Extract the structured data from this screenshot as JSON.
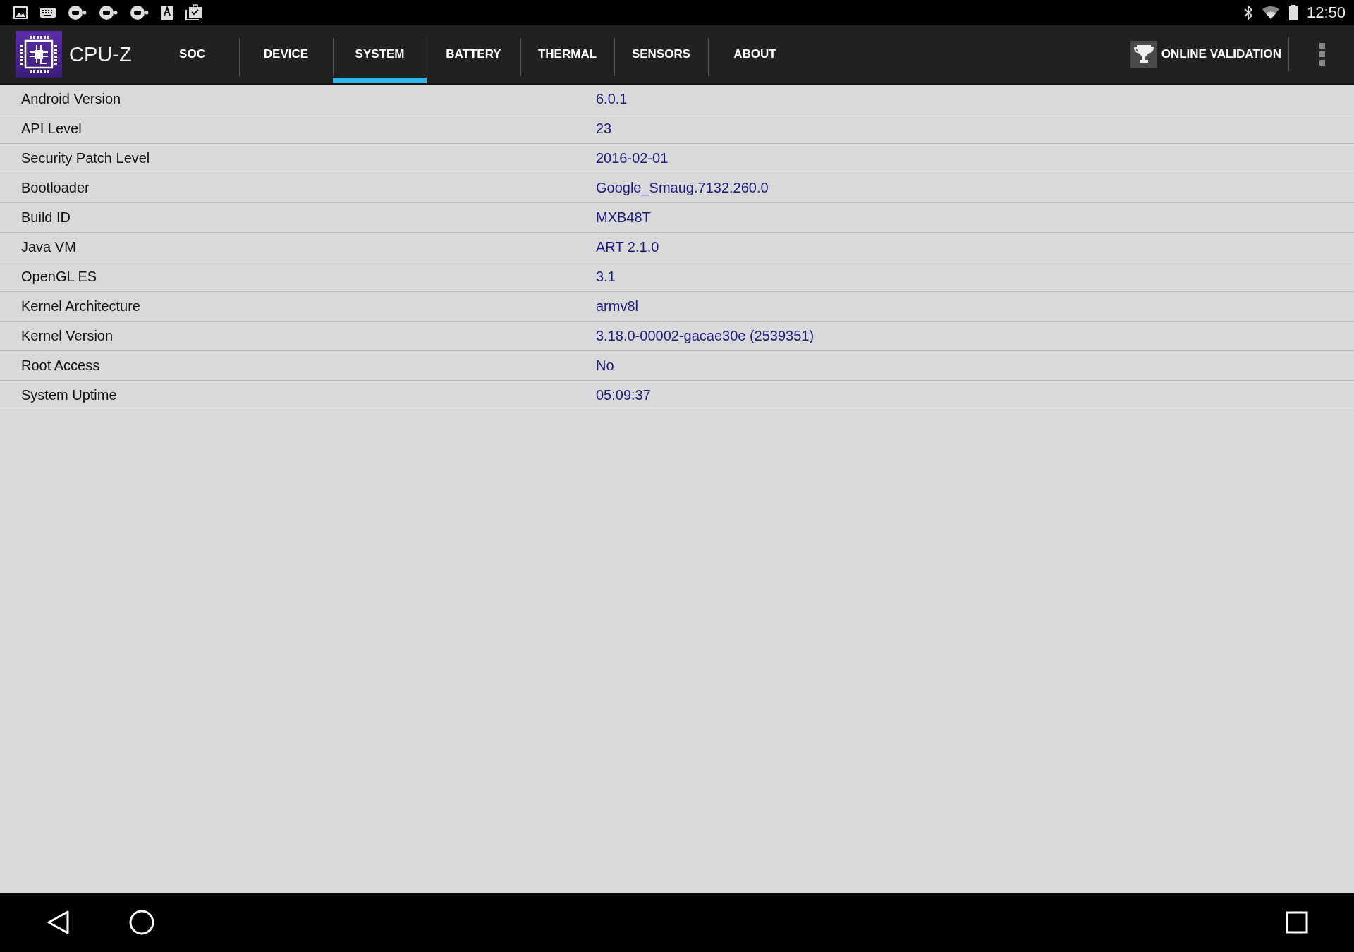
{
  "status_bar": {
    "time": "12:50"
  },
  "app_bar": {
    "title": "CPU-Z",
    "tabs": [
      {
        "label": "SOC",
        "selected": false
      },
      {
        "label": "DEVICE",
        "selected": false
      },
      {
        "label": "SYSTEM",
        "selected": true
      },
      {
        "label": "BATTERY",
        "selected": false
      },
      {
        "label": "THERMAL",
        "selected": false
      },
      {
        "label": "SENSORS",
        "selected": false
      },
      {
        "label": "ABOUT",
        "selected": false
      }
    ],
    "validation_button": {
      "label": "ONLINE VALIDATION"
    }
  },
  "rows": [
    {
      "label": "Android Version",
      "value": "6.0.1"
    },
    {
      "label": "API Level",
      "value": "23"
    },
    {
      "label": "Security Patch Level",
      "value": "2016-02-01"
    },
    {
      "label": "Bootloader",
      "value": "Google_Smaug.7132.260.0"
    },
    {
      "label": "Build ID",
      "value": "MXB48T"
    },
    {
      "label": "Java VM",
      "value": "ART 2.1.0"
    },
    {
      "label": "OpenGL ES",
      "value": "3.1"
    },
    {
      "label": "Kernel Architecture",
      "value": "armv8l"
    },
    {
      "label": "Kernel Version",
      "value": "3.18.0-00002-gacae30e (2539351)"
    },
    {
      "label": "Root Access",
      "value": "No"
    },
    {
      "label": "System Uptime",
      "value": "05:09:37"
    }
  ]
}
